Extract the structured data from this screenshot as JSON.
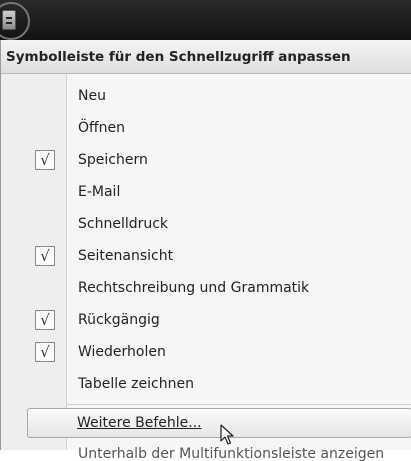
{
  "header": {
    "title": "Symbolleiste für den Schnellzugriff anpassen"
  },
  "items": [
    {
      "label": "Neu",
      "checked": false
    },
    {
      "label": "Öffnen",
      "checked": false
    },
    {
      "label": "Speichern",
      "checked": true
    },
    {
      "label": "E-Mail",
      "checked": false
    },
    {
      "label": "Schnelldruck",
      "checked": false
    },
    {
      "label": "Seitenansicht",
      "checked": true
    },
    {
      "label": "Rechtschreibung und Grammatik",
      "checked": false
    },
    {
      "label": "Rückgängig",
      "checked": true
    },
    {
      "label": "Wiederholen",
      "checked": true
    },
    {
      "label": "Tabelle zeichnen",
      "checked": false
    }
  ],
  "more_commands": {
    "label": "Weitere Befehle..."
  },
  "check_glyph": "√",
  "partial_item": {
    "label": "Unterhalb der Multifunktionsleiste anzeigen"
  }
}
